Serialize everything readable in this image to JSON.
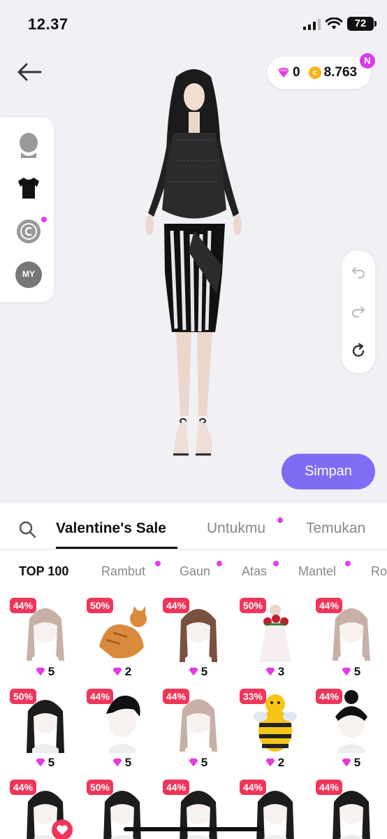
{
  "status": {
    "time": "12.37",
    "battery": "72"
  },
  "currency": {
    "gems": "0",
    "coins": "8.763",
    "badge": "N",
    "coin_symbol": "c"
  },
  "left_panel": {
    "my_label": "MY"
  },
  "actions": {
    "save_label": "Simpan"
  },
  "tabs": [
    {
      "label": "Valentine's Sale",
      "active": true
    },
    {
      "label": "Untukmu",
      "dot": true
    },
    {
      "label": "Temukan"
    }
  ],
  "categories": [
    {
      "label": "TOP 100",
      "active": true
    },
    {
      "label": "Rambut",
      "dot": true
    },
    {
      "label": "Gaun",
      "dot": true
    },
    {
      "label": "Atas",
      "dot": true
    },
    {
      "label": "Mantel",
      "dot": true
    },
    {
      "label": "Ro"
    }
  ],
  "items": [
    {
      "discount": "44%",
      "price": "5",
      "kind": "hair-light"
    },
    {
      "discount": "50%",
      "price": "2",
      "kind": "cat"
    },
    {
      "discount": "44%",
      "price": "5",
      "kind": "hair-brown"
    },
    {
      "discount": "50%",
      "price": "3",
      "kind": "dress-roses"
    },
    {
      "discount": "44%",
      "price": "5",
      "kind": "hair-light"
    },
    {
      "discount": "50%",
      "price": "5",
      "kind": "hair-black"
    },
    {
      "discount": "44%",
      "price": "5",
      "kind": "hair-short-black"
    },
    {
      "discount": "44%",
      "price": "5",
      "kind": "hair-light"
    },
    {
      "discount": "33%",
      "price": "2",
      "kind": "bee"
    },
    {
      "discount": "44%",
      "price": "5",
      "kind": "hair-bun"
    },
    {
      "discount": "44%",
      "price": "",
      "kind": "hair-black"
    },
    {
      "discount": "50%",
      "price": "",
      "kind": "hair-black"
    },
    {
      "discount": "44%",
      "price": "",
      "kind": "hair-black"
    },
    {
      "discount": "44%",
      "price": "",
      "kind": "hair-black"
    },
    {
      "discount": "44%",
      "price": "",
      "kind": "hair-black"
    }
  ],
  "colors": {
    "accent": "#6c56f5",
    "discount": "#f0355a",
    "dot": "#e33ded",
    "gem": "#e63bdf",
    "coin": "#f5b41a"
  }
}
